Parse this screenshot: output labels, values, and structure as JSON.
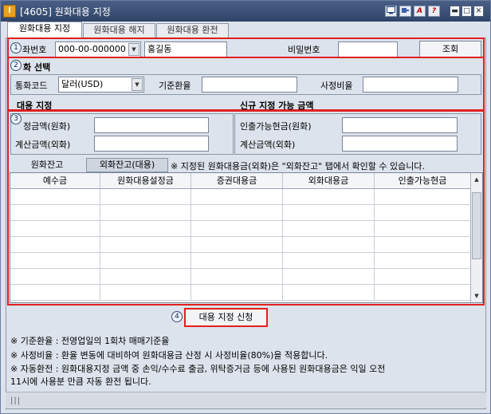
{
  "window": {
    "title": "[4605] 원화대용 지정",
    "icon_label": "I",
    "toolbar_icons": [
      "monitor-icon",
      "pin-icon",
      "font-icon",
      "help-icon"
    ],
    "toolbar_labels": {
      "font": "A",
      "help": "?"
    },
    "window_buttons": [
      "minimize-icon",
      "maximize-icon",
      "close-icon"
    ],
    "window_button_labels": {
      "minimize": "▬",
      "maximize": "□",
      "close": "✕"
    }
  },
  "tabs": [
    {
      "label": "원화대용 지정",
      "active": true
    },
    {
      "label": "원화대용 해지",
      "active": false
    },
    {
      "label": "원화대용 환전",
      "active": false
    }
  ],
  "section1": {
    "badge": "1",
    "account_label": "좌번호",
    "account_value": "000-00-000000",
    "name_value": "홍길동",
    "password_label": "비밀번호",
    "password_value": "",
    "search_button": "조회"
  },
  "section2": {
    "badge": "2",
    "heading": "화 선택",
    "currency_label": "통화코드",
    "currency_value": "달러(USD)",
    "base_rate_label": "기준환율",
    "base_rate_value": "",
    "assess_rate_label": "사정비율",
    "assess_rate_value": ""
  },
  "section3": {
    "badge": "3",
    "left_heading": "대용 지정",
    "right_heading": "신규 지정 가능 금액",
    "set_amount_label": "정금액(원화)",
    "set_amount_value": "",
    "calc_amount_label": "계산금액(외화)",
    "calc_amount_value": "",
    "withdraw_label": "인출가능현금(원화)",
    "withdraw_value": "",
    "right_calc_label": "계산금액(외화)",
    "right_calc_value": "",
    "subtabs": [
      "원화잔고",
      "외화잔고(대용)"
    ],
    "subtab_note": "※ 지정된 원화대용금(외화)은 \"외화잔고\" 탭에서 확인할 수 있습니다.",
    "columns": [
      "예수금",
      "원화대용설정금",
      "증권대용금",
      "외화대용금",
      "인출가능현금"
    ]
  },
  "section4": {
    "badge": "4",
    "apply_button": "대용 지정 신청"
  },
  "notes": [
    "※ 기준환율 : 전영업일의 1회차 매매기준율",
    "※ 사정비율 : 환율 변동에 대비하여 원화대용금 산정 시 사정비율(80%)을 적용합니다.",
    "※ 자동환전 : 원화대용지정 금액 중 손익/수수료 출금, 위탁증거금 등에 사용된 원화대용금은 익일 오전",
    "11시에 사용분 만큼 자동 환전 됩니다."
  ],
  "status": {
    "grip": "|||"
  },
  "colors": {
    "highlight": "#e02020",
    "titlebar": "#3a4f78",
    "background": "#dde3ec"
  }
}
